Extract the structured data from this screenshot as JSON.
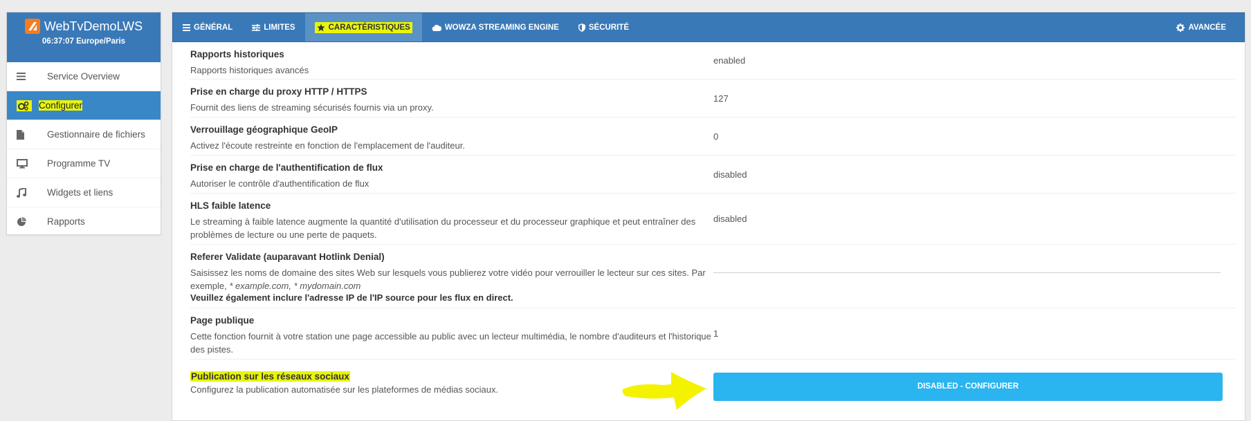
{
  "app": {
    "name": "WebTvDemoLWS",
    "time": "06:37:07 Europe/Paris"
  },
  "sidebar": {
    "items": [
      {
        "label": "Service Overview",
        "icon": "menu-icon"
      },
      {
        "label": "Configurer",
        "icon": "cogs-icon",
        "active": true
      },
      {
        "label": "Gestionnaire de fichiers",
        "icon": "file-icon"
      },
      {
        "label": "Programme TV",
        "icon": "monitor-icon"
      },
      {
        "label": "Widgets et liens",
        "icon": "music-icon"
      },
      {
        "label": "Rapports",
        "icon": "pie-chart-icon"
      }
    ]
  },
  "tabs": [
    {
      "label": "GÉNÉRAL",
      "icon": "menu-icon"
    },
    {
      "label": "LIMITES",
      "icon": "sliders-icon"
    },
    {
      "label": "CARACTÉRISTIQUES",
      "icon": "star-icon",
      "active": true
    },
    {
      "label": "WOWZA STREAMING ENGINE",
      "icon": "cloud-icon"
    },
    {
      "label": "SÉCURITÉ",
      "icon": "shield-icon"
    },
    {
      "label": "AVANCÉE",
      "icon": "gear-icon"
    }
  ],
  "settings": [
    {
      "title": "Rapports historiques",
      "desc": "Rapports historiques avancés",
      "value": "enabled"
    },
    {
      "title": "Prise en charge du proxy HTTP / HTTPS",
      "desc": "Fournit des liens de streaming sécurisés fournis via un proxy.",
      "value": "127"
    },
    {
      "title": "Verrouillage géographique GeoIP",
      "desc": "Activez l'écoute restreinte en fonction de l'emplacement de l'auditeur.",
      "value": "0"
    },
    {
      "title": "Prise en charge de l'authentification de flux",
      "desc": "Autoriser le contrôle d'authentification de flux",
      "value": "disabled"
    },
    {
      "title": "HLS faible latence",
      "desc": "Le streaming à faible latence augmente la quantité d'utilisation du processeur et du processeur graphique et peut entraîner des problèmes de lecture ou une perte de paquets.",
      "value": "disabled"
    },
    {
      "title": "Page publique",
      "desc": "Cette fonction fournit à votre station une page accessible au public avec un lecteur multimédia, le nombre d'auditeurs et l'historique des pistes.",
      "value": "1"
    }
  ],
  "referer": {
    "title": "Referer Validate (auparavant Hotlink Denial)",
    "desc": "Saisissez les noms de domaine des sites Web sur lesquels vous publierez votre vidéo pour verrouiller le lecteur sur ces sites. Par exemple,",
    "examples": "* example.com, * mydomain.com",
    "note": "Veuillez également inclure l'adresse IP de l'IP source pour les flux en direct.",
    "value": ""
  },
  "social": {
    "title": "Publication sur les réseaux sociaux",
    "desc": "Configurez la publication automatisée sur les plateformes de médias sociaux.",
    "button": "DISABLED - CONFIGURER"
  },
  "colors": {
    "header_blue": "#3a79b8",
    "active_blue": "#3a87c8",
    "highlight": "#e8f50a",
    "button": "#2ab4f0"
  }
}
